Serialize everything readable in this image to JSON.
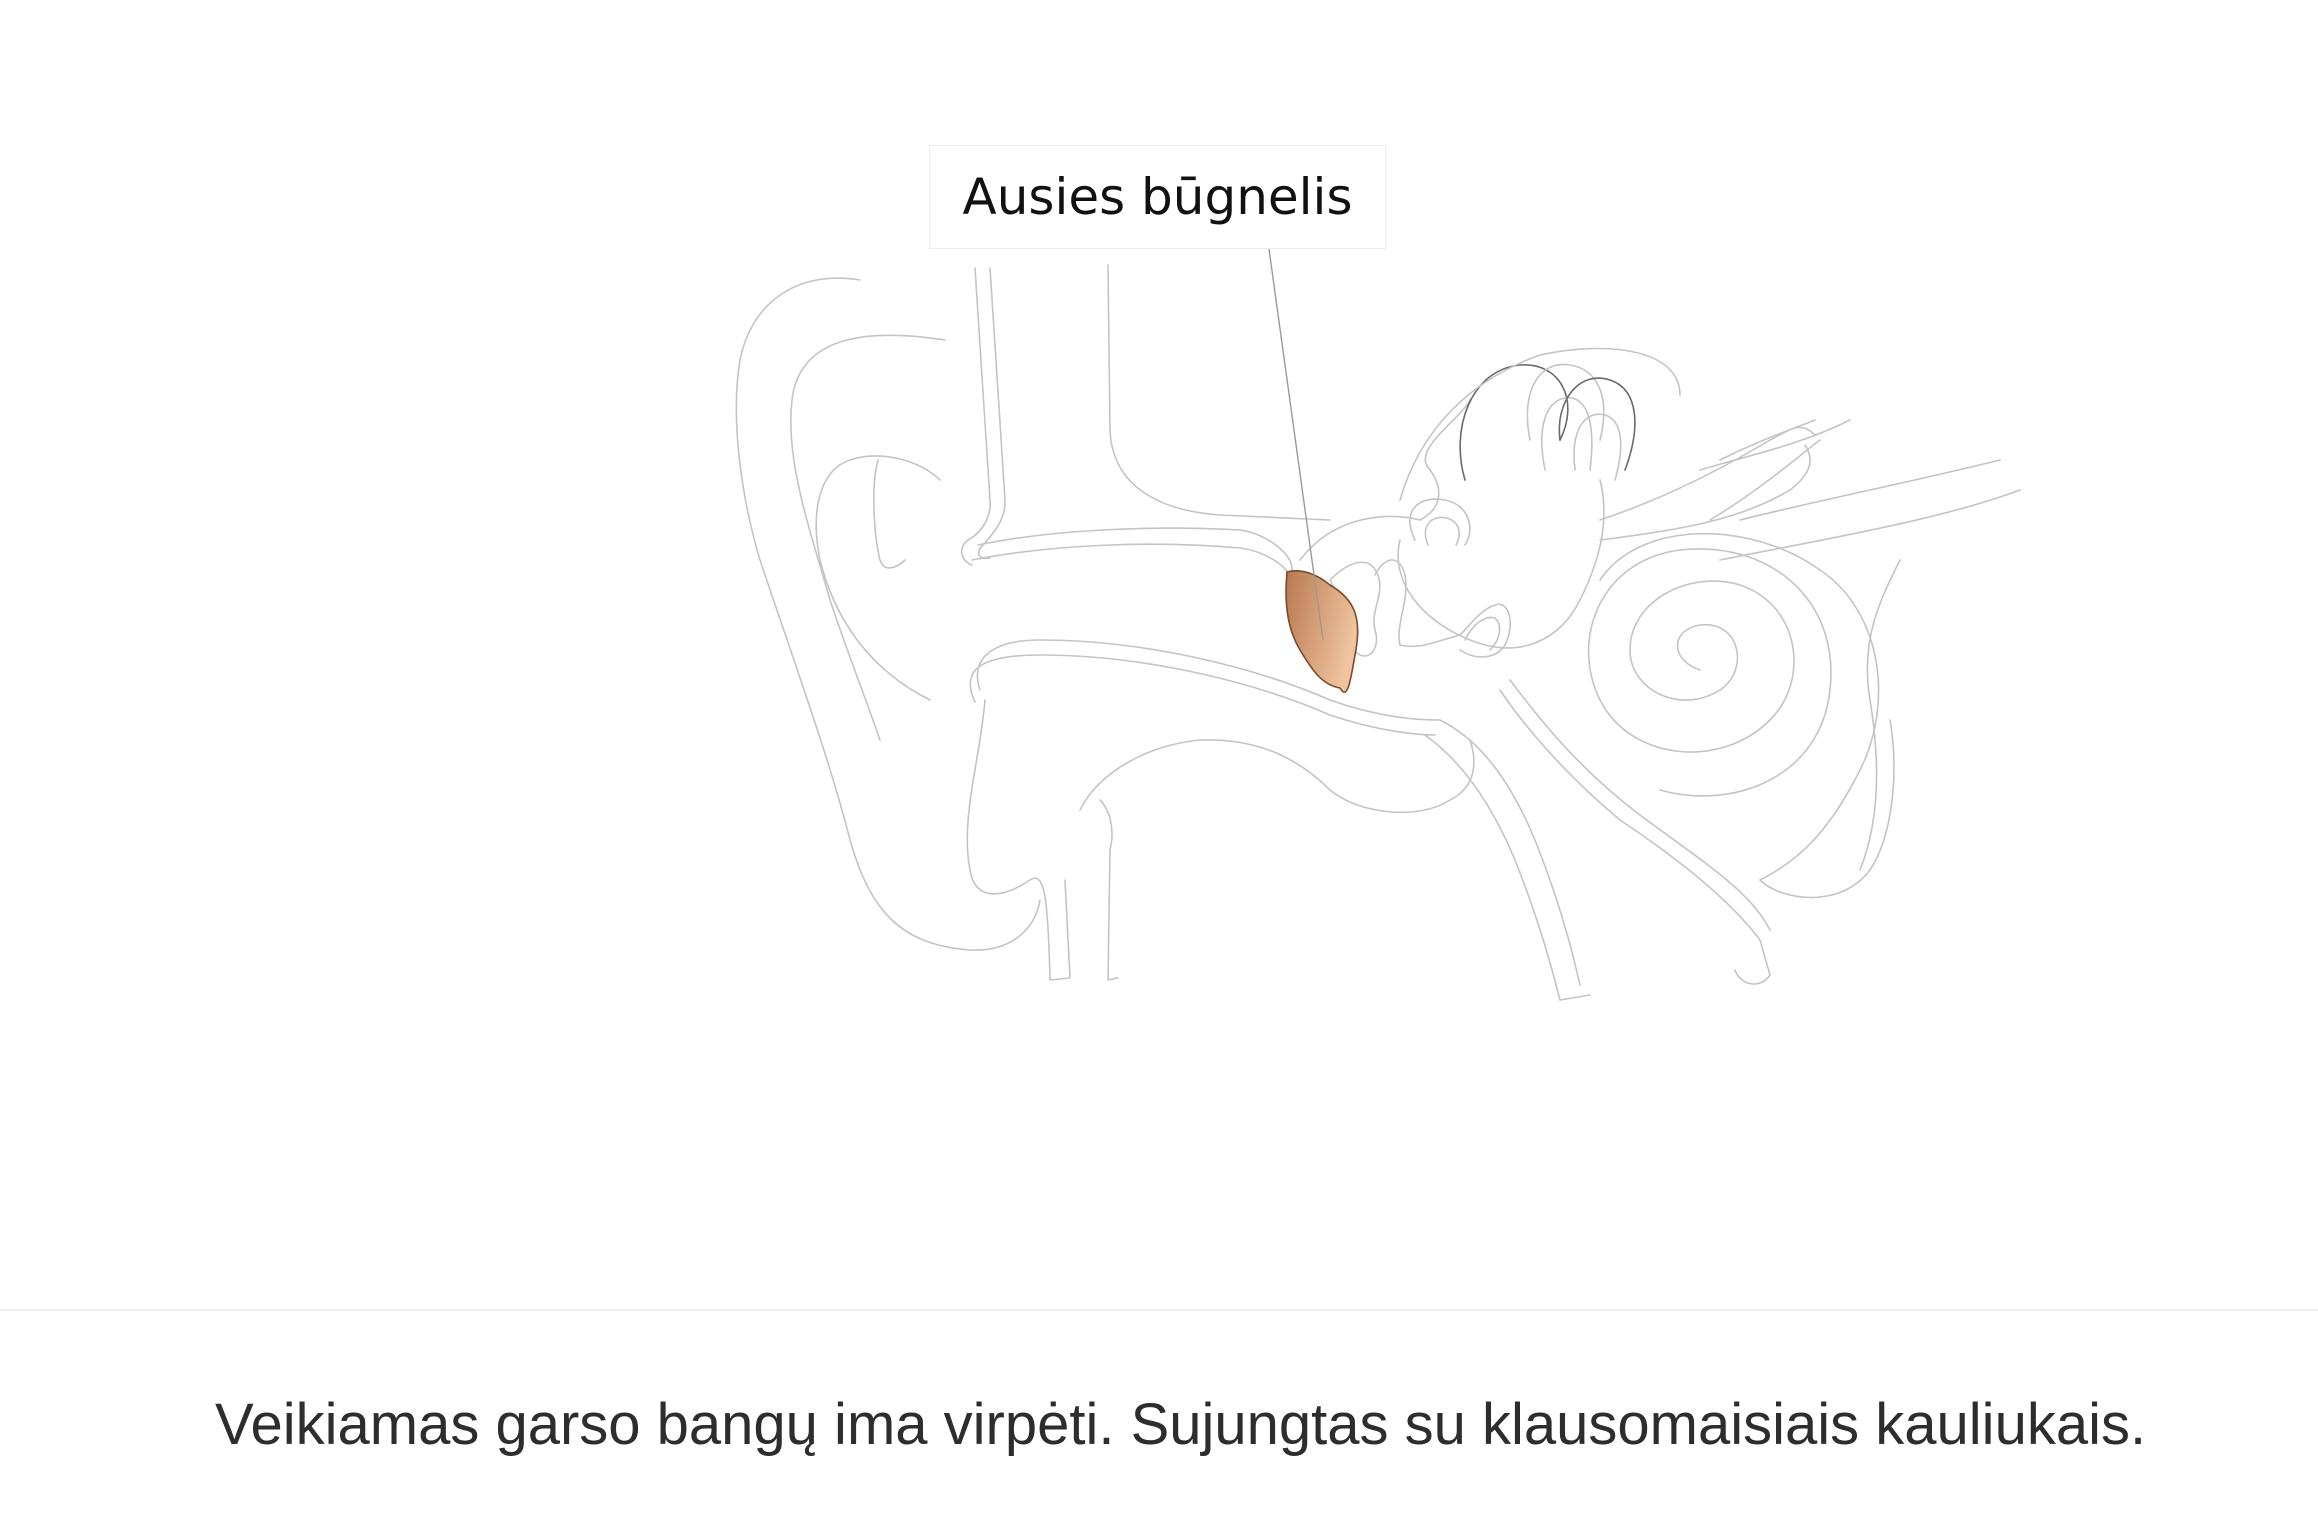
{
  "diagram": {
    "highlighted_part_label": "Ausies būgnelis",
    "highlight_color": "#c9895f",
    "highlight_gradient_light": "#ecc09a",
    "outline_color": "#c4c4c4"
  },
  "caption": {
    "text": "Veikiamas garso bangų ima virpėti. Sujungtas su klausomaisiais kauliukais."
  }
}
